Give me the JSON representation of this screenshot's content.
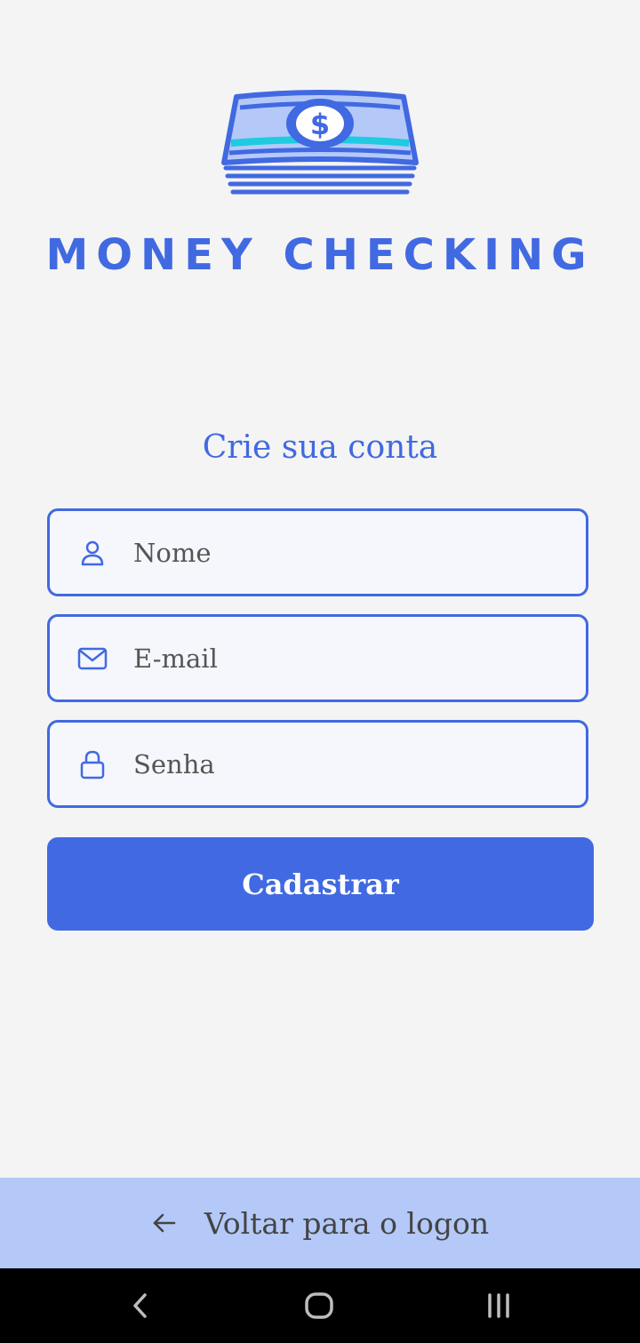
{
  "logo": {
    "text": "MONEY CHECKING",
    "icon": "money-stack-icon"
  },
  "form": {
    "title": "Crie sua conta",
    "fields": [
      {
        "placeholder": "Nome",
        "value": "",
        "icon": "user-icon"
      },
      {
        "placeholder": "E-mail",
        "value": "",
        "icon": "mail-icon"
      },
      {
        "placeholder": "Senha",
        "value": "",
        "icon": "lock-icon"
      }
    ],
    "submit_label": "Cadastrar"
  },
  "footer": {
    "back_label": "Voltar para o logon",
    "icon": "arrow-left-icon"
  },
  "system_nav": {
    "back": "chevron-left-icon",
    "home": "home-icon",
    "recents": "recents-icon"
  },
  "colors": {
    "primary": "#4169e1",
    "background": "#f4f4f4",
    "footer": "#b4c9f8",
    "logo_light": "#b4c9f8",
    "logo_accent": "#1ecbe1"
  }
}
